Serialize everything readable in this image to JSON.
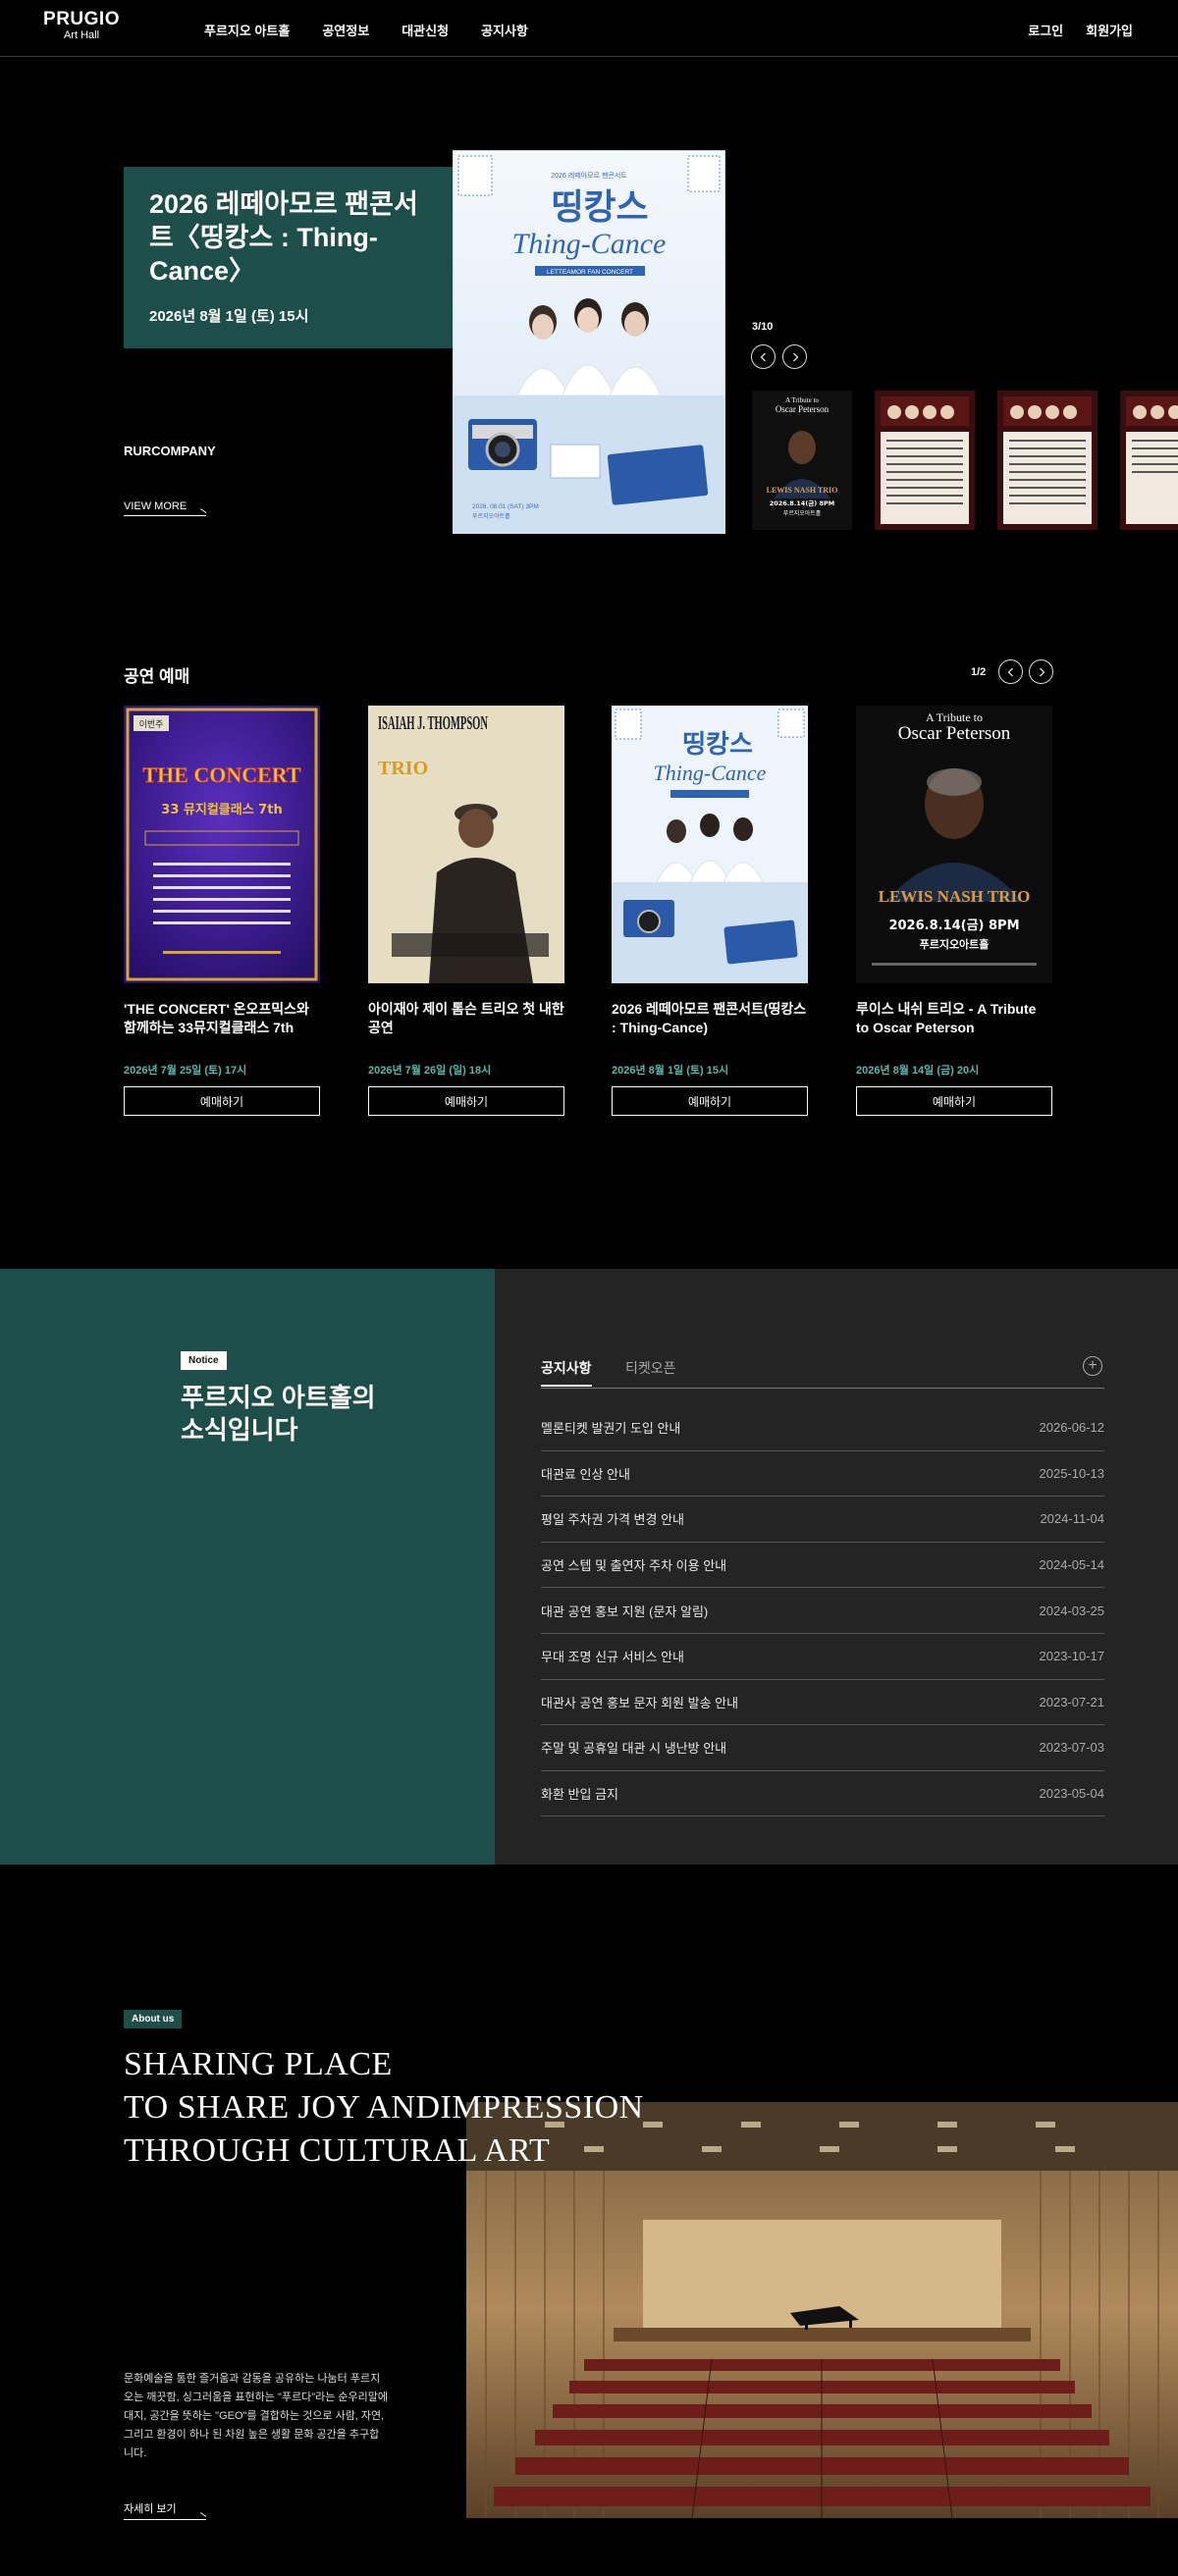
{
  "header": {
    "logo_line1": "PRUGIO",
    "logo_line2": "Art Hall",
    "nav": [
      "푸르지오 아트홀",
      "공연정보",
      "대관신청",
      "공지사항"
    ],
    "login": "로그인",
    "signup": "회원가입"
  },
  "hero": {
    "title": "2026 레떼아모르 팬콘서트〈띵캉스 : Thing-Cance〉",
    "date": "2026년 8월 1일 (토) 15시",
    "company": "RURCOMPANY",
    "view_more": "VIEW MORE",
    "counter": "3/10",
    "poster": {
      "top_small": "2026 레떼아모르 팬콘서트",
      "main": "띵캉스",
      "sub": "Thing-Cance",
      "banner": "LETTEAMOR FAN CONCERT",
      "bottom": "2026. 08.01 (SAT) 3PM",
      "venue": "푸르지오아트홀"
    },
    "thumbs": [
      {
        "line1": "A Tribute to",
        "line2": "Oscar Peterson",
        "name": "LEWIS NASH TRIO",
        "date": "2026.8.14(금) 8PM",
        "venue": "푸르지오아트홀"
      }
    ]
  },
  "booking": {
    "title": "공연 예매",
    "counter": "1/2",
    "button_label": "예매하기",
    "cards": [
      {
        "title": "'THE CONCERT' 온오프믹스와 함께하는 33뮤지컬클래스 7th",
        "date": "2026년 7월 25일 (토) 17시",
        "badge": "이번주",
        "poster_main": "THE CONCERT",
        "poster_sub": "33 뮤지컬클래스 7th"
      },
      {
        "title": "아이재아 제이 톰슨 트리오 첫 내한 공연",
        "date": "2026년 7월 26일 (일) 18시",
        "poster_main": "ISAIAH J. THOMPSON",
        "poster_sub": "TRIO"
      },
      {
        "title": "2026 레떼아모르 팬콘서트(띵캉스 : Thing-Cance)",
        "date": "2026년 8월 1일 (토) 15시",
        "poster_main": "띵캉스",
        "poster_sub": "Thing-Cance"
      },
      {
        "title": "루이스 내쉬 트리오 - A Tribute to Oscar Peterson",
        "date": "2026년 8월 14일 (금) 20시",
        "poster_main": "A Tribute to",
        "poster_sub": "Oscar Peterson",
        "poster_name": "LEWIS NASH TRIO",
        "poster_date": "2026.8.14(금) 8PM",
        "poster_venue": "푸르지오아트홀"
      }
    ]
  },
  "notice": {
    "badge": "Notice",
    "heading_line1": "푸르지오 아트홀의",
    "heading_line2": "소식입니다",
    "tab_active": "공지사항",
    "tab_inactive": "티켓오픈",
    "items": [
      {
        "title": "멜론티켓 발권기 도입 안내",
        "date": "2026-06-12"
      },
      {
        "title": "대관료 인상 안내",
        "date": "2025-10-13"
      },
      {
        "title": "평일 주차권 가격 변경 안내",
        "date": "2024-11-04"
      },
      {
        "title": "공연 스텝 및 출연자 주차 이용 안내",
        "date": "2024-05-14"
      },
      {
        "title": "대관 공연 홍보 지원 (문자 알림)",
        "date": "2024-03-25"
      },
      {
        "title": "무대 조명 신규 서비스 안내",
        "date": "2023-10-17"
      },
      {
        "title": "대관사 공연 홍보 문자 회원 발송 안내",
        "date": "2023-07-21"
      },
      {
        "title": "주말 및 공휴일 대관 시 냉난방 안내",
        "date": "2023-07-03"
      },
      {
        "title": "화환 반입 금지",
        "date": "2023-05-04"
      }
    ]
  },
  "about": {
    "badge": "About us",
    "heading_line1": "SHARING PLACE",
    "heading_line2": "TO SHARE JOY ANDIMPRESSION",
    "heading_line3": "THROUGH CULTURAL ART",
    "body": "문화예술을 통한 즐거움과 감동을 공유하는 나눔터 푸르지오는 깨끗함, 싱그러움을 표현하는 \"푸르다\"라는 순우리말에 대지, 공간을 뜻하는 \"GEO\"를 결합하는 것으로 사람, 자연, 그리고 환경이 하나 된 차원 높은 생활 문화 공간을 추구합니다.",
    "more": "자세히 보기"
  }
}
